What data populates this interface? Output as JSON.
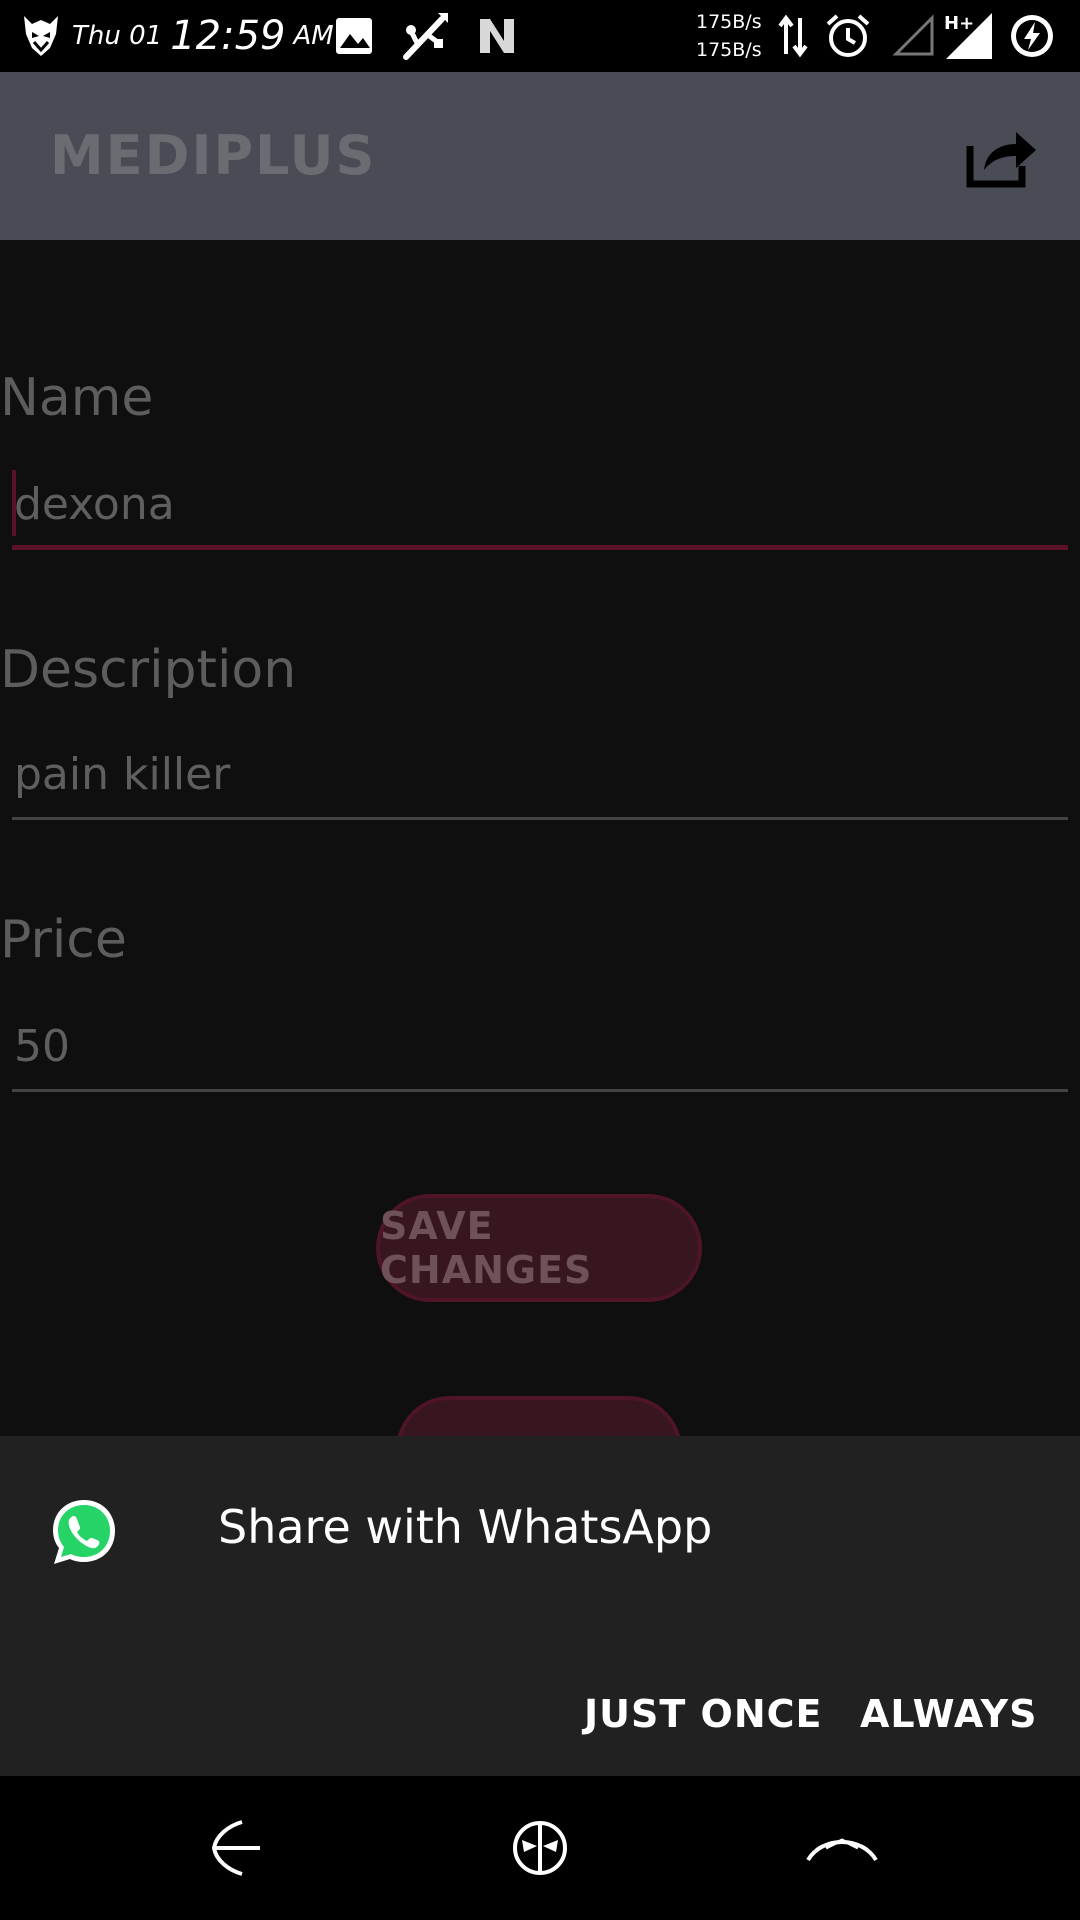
{
  "status_bar": {
    "day": "Thu 01",
    "time": "12:59",
    "ampm": "AM",
    "net_up": "175B/s",
    "net_down": "175B/s"
  },
  "app_bar": {
    "title": "MEDIPLUS",
    "share_icon": "share-icon"
  },
  "form": {
    "name_label": "Name",
    "name_value": "dexona",
    "description_label": "Description",
    "description_value": "pain killer",
    "price_label": "Price",
    "price_value": "50",
    "save_button": "SAVE CHANGES"
  },
  "share_sheet": {
    "app_icon": "whatsapp-icon",
    "title": "Share with WhatsApp",
    "just_once": "JUST ONCE",
    "always": "ALWAYS"
  },
  "nav_bar": {
    "back_icon": "back-icon",
    "home_icon": "home-icon",
    "recents_icon": "recents-icon"
  },
  "colors": {
    "accent": "#5a1226",
    "app_bar": "#4a4c55",
    "sheet": "#212121",
    "whatsapp": "#25d366"
  }
}
